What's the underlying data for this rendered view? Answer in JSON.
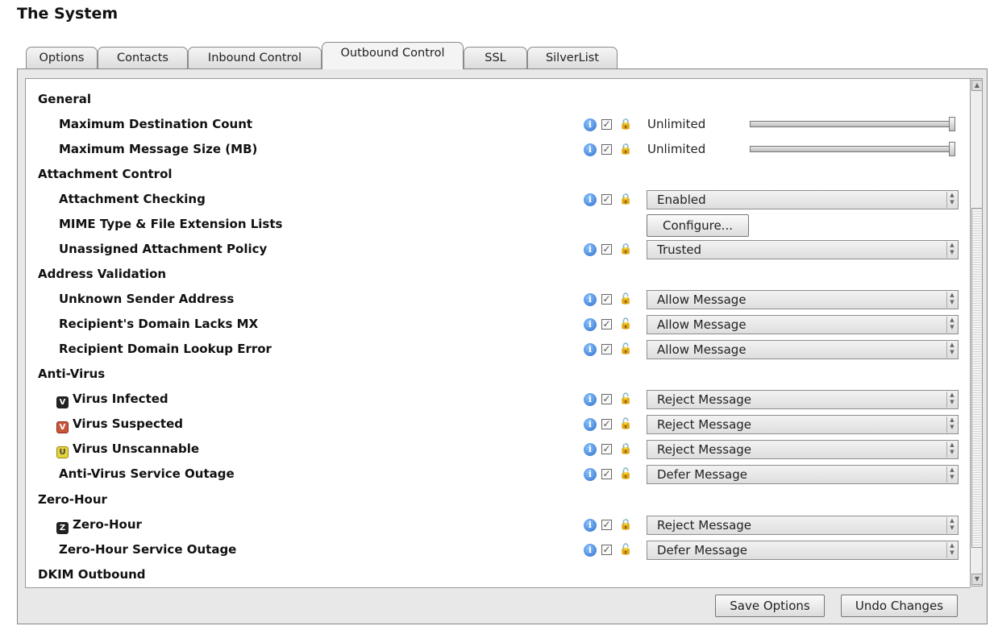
{
  "page_title": "The System",
  "tabs": [
    {
      "label": "Options"
    },
    {
      "label": "Contacts"
    },
    {
      "label": "Inbound Control"
    },
    {
      "label": "Outbound Control"
    },
    {
      "label": "SSL"
    },
    {
      "label": "SilverList"
    }
  ],
  "active_tab": "Outbound Control",
  "sections": {
    "general": "General",
    "attachment_control": "Attachment Control",
    "address_validation": "Address Validation",
    "anti_virus": "Anti-Virus",
    "zero_hour": "Zero-Hour",
    "dkim_outbound": "DKIM Outbound"
  },
  "rows": {
    "max_dest": {
      "label": "Maximum Destination Count",
      "value": "Unlimited",
      "slider_level": 1.0,
      "lock": "locked"
    },
    "max_size": {
      "label": "Maximum Message Size (MB)",
      "value": "Unlimited",
      "slider_level": 1.0,
      "lock": "locked"
    },
    "attach_check": {
      "label": "Attachment Checking",
      "value": "Enabled",
      "lock": "locked"
    },
    "mime_lists": {
      "label": "MIME Type & File Extension Lists",
      "button": "Configure..."
    },
    "unassigned_policy": {
      "label": "Unassigned Attachment Policy",
      "value": "Trusted",
      "lock": "locked"
    },
    "unknown_sender": {
      "label": "Unknown Sender Address",
      "value": "Allow Message",
      "lock": "unlocked"
    },
    "no_mx": {
      "label": "Recipient's Domain Lacks MX",
      "value": "Allow Message",
      "lock": "unlocked"
    },
    "lookup_error": {
      "label": "Recipient Domain Lookup Error",
      "value": "Allow Message",
      "lock": "unlocked"
    },
    "virus_infected": {
      "label": "Virus Infected",
      "badge": "V",
      "value": "Reject Message",
      "lock": "unlocked"
    },
    "virus_suspected": {
      "label": "Virus Suspected",
      "badge": "V",
      "value": "Reject Message",
      "lock": "unlocked"
    },
    "virus_unscannable": {
      "label": "Virus Unscannable",
      "badge": "U",
      "value": "Reject Message",
      "lock": "locked"
    },
    "av_outage": {
      "label": "Anti-Virus Service Outage",
      "value": "Defer Message",
      "lock": "unlocked"
    },
    "zero_hour": {
      "label": "Zero-Hour",
      "badge": "Z",
      "value": "Reject Message",
      "lock": "locked"
    },
    "zh_outage": {
      "label": "Zero-Hour Service Outage",
      "value": "Defer Message",
      "lock": "unlocked"
    }
  },
  "icons": {
    "info": "info-icon",
    "check": "checkbox-icon",
    "locked": "lock-icon",
    "unlocked": "unlock-icon"
  },
  "buttons": {
    "save": "Save Options",
    "undo": "Undo Changes"
  }
}
